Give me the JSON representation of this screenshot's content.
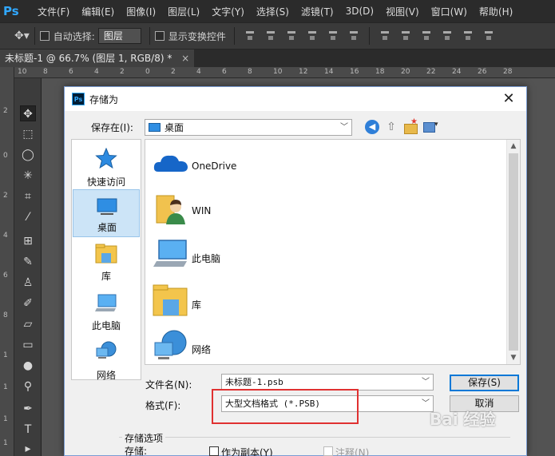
{
  "app": {
    "logo": "Ps",
    "menu": [
      "文件(F)",
      "编辑(E)",
      "图像(I)",
      "图层(L)",
      "文字(Y)",
      "选择(S)",
      "滤镜(T)",
      "3D(D)",
      "视图(V)",
      "窗口(W)",
      "帮助(H)"
    ],
    "options": {
      "auto_select_label": "自动选择:",
      "auto_select_value": "图层",
      "show_transform_label": "显示变换控件"
    },
    "doc_tab": {
      "title": "未标题-1 @ 66.7% (图层 1, RGB/8) *",
      "close": "×"
    },
    "ruler_h": [
      "10",
      "8",
      "6",
      "4",
      "2",
      "0",
      "2",
      "4",
      "6",
      "8",
      "10",
      "12",
      "14",
      "16",
      "18",
      "20",
      "22",
      "24",
      "26",
      "28"
    ],
    "ruler_v": [
      "2",
      "0",
      "2",
      "4",
      "6",
      "8",
      "1",
      "1",
      "1",
      "1"
    ]
  },
  "dialog": {
    "title": "存储为",
    "close": "✕",
    "save_in_label": "保存在(I):",
    "save_in_value": "桌面",
    "places": [
      {
        "label": "快速访问",
        "icon": "star-icon"
      },
      {
        "label": "桌面",
        "icon": "desktop-icon"
      },
      {
        "label": "库",
        "icon": "library-icon"
      },
      {
        "label": "此电脑",
        "icon": "computer-icon"
      },
      {
        "label": "网络",
        "icon": "network-icon"
      }
    ],
    "files": [
      {
        "label": "OneDrive",
        "icon": "cloud-icon"
      },
      {
        "label": "WIN",
        "icon": "user-folder-icon"
      },
      {
        "label": "此电脑",
        "icon": "computer-icon"
      },
      {
        "label": "库",
        "icon": "library-icon"
      },
      {
        "label": "网络",
        "icon": "network-icon"
      }
    ],
    "filename_label": "文件名(N):",
    "filename_value": "未标题-1.psb",
    "format_label": "格式(F):",
    "format_value": "大型文档格式 (*.PSB)",
    "save_button": "保存(S)",
    "cancel_button": "取消",
    "save_options_title": "存储选项",
    "save_options_save_label": "存储:",
    "as_copy_label": "作为副本(Y)",
    "notes_label": "注释(N)"
  },
  "watermark": "Bai 经验",
  "colors": {
    "highlight": "#e03131",
    "ps_blue": "#31a8ff",
    "selection": "#cce4f7"
  }
}
